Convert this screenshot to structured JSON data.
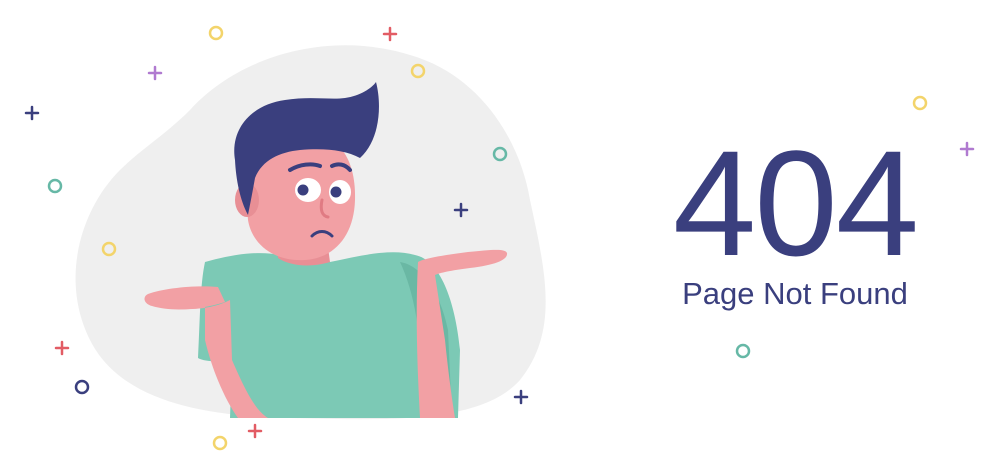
{
  "error": {
    "code": "404",
    "message": "Page Not Found"
  },
  "colors": {
    "primary_navy": "#3a3f7e",
    "shirt_teal": "#7cc9b5",
    "skin_pink": "#f2a0a4",
    "blob_gray": "#efefef",
    "accent_yellow": "#f3d46b",
    "accent_red": "#e25c64",
    "accent_purple": "#b07ad0",
    "accent_teal": "#66b8a6"
  },
  "illustration": {
    "subject": "shrugging-man",
    "decorations": [
      "plus-icon",
      "circle-icon"
    ]
  }
}
